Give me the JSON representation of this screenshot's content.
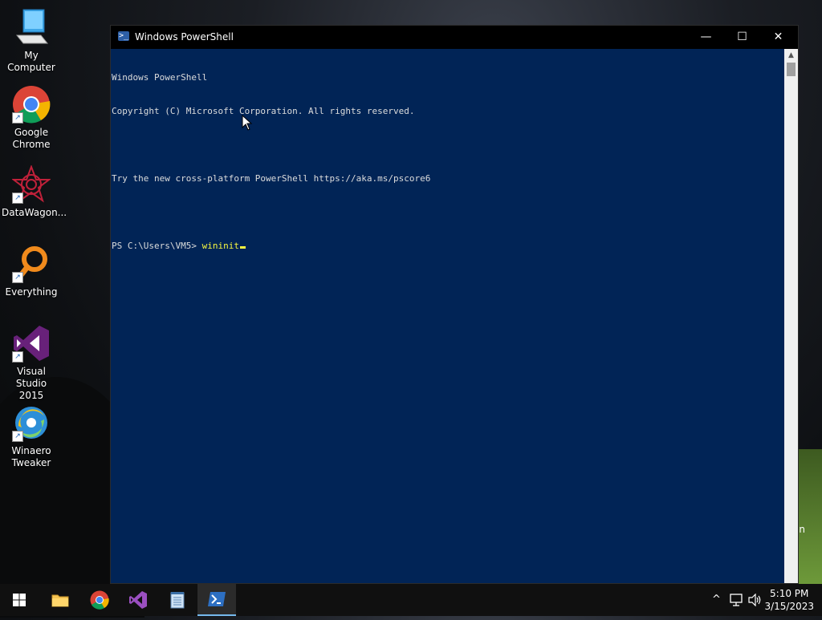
{
  "desktop": {
    "icons": [
      {
        "label": "My Computer",
        "icon": "computer-icon"
      },
      {
        "label": "Google\nChrome",
        "icon": "chrome-icon"
      },
      {
        "label": "DataWagon...",
        "icon": "datawagon-icon"
      },
      {
        "label": "Everything",
        "icon": "everything-search-icon"
      },
      {
        "label": "Visual Studio\n2015",
        "icon": "visual-studio-icon"
      },
      {
        "label": "Winaero\nTweaker",
        "icon": "winaero-tweaker-icon"
      }
    ],
    "partial_text": "in"
  },
  "window": {
    "title": "Windows PowerShell",
    "controls": {
      "minimize": "—",
      "maximize": "☐",
      "close": "✕"
    }
  },
  "console": {
    "lines": [
      "Windows PowerShell",
      "Copyright (C) Microsoft Corporation. All rights reserved.",
      "",
      "Try the new cross-platform PowerShell https://aka.ms/pscore6",
      ""
    ],
    "prompt": "PS C:\\Users\\VM5> ",
    "command": "wininit"
  },
  "taskbar": {
    "buttons": [
      {
        "name": "start-button",
        "icon": "windows-logo-icon"
      },
      {
        "name": "file-explorer-button",
        "icon": "folder-icon"
      },
      {
        "name": "chrome-taskbar-button",
        "icon": "chrome-icon"
      },
      {
        "name": "visual-studio-taskbar-button",
        "icon": "visual-studio-icon"
      },
      {
        "name": "notepad-taskbar-button",
        "icon": "notepad-icon"
      },
      {
        "name": "powershell-taskbar-button",
        "icon": "powershell-icon",
        "active": true
      }
    ],
    "tray": {
      "chevron": "^",
      "network_icon": "network-icon",
      "volume_icon": "volume-icon"
    },
    "clock": {
      "time": "5:10 PM",
      "date": "3/15/2023"
    }
  },
  "colors": {
    "console_bg": "#012456",
    "console_text": "#dcdcdc",
    "command_text": "#f7f740",
    "taskbar_bg": "#101010",
    "active_indicator": "#76b9ed"
  }
}
